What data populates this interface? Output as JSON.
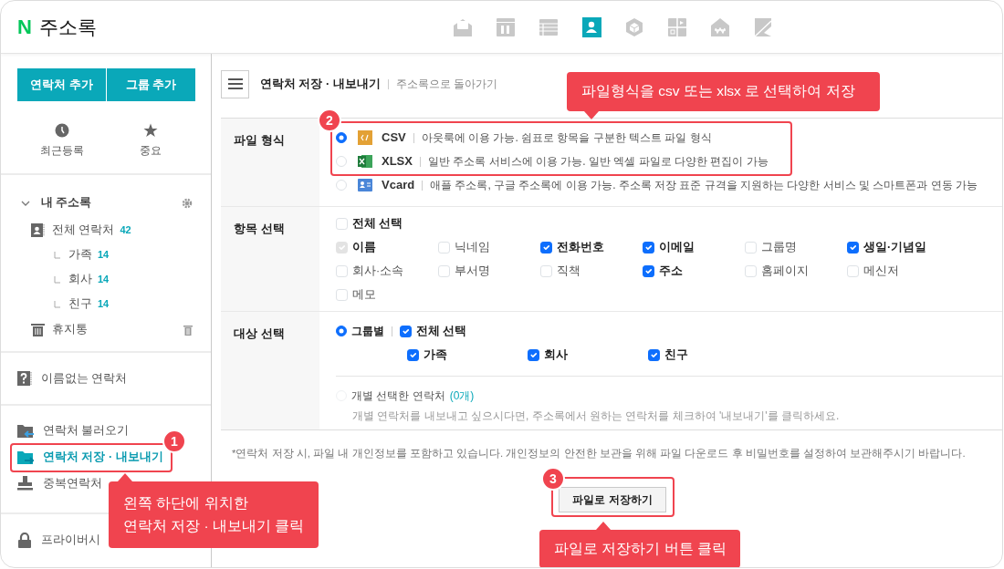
{
  "app": {
    "logo": "N",
    "title": "주소록"
  },
  "app_icons": [
    {
      "kind": "mail",
      "selected": false
    },
    {
      "kind": "calendar",
      "selected": false
    },
    {
      "kind": "table",
      "selected": false
    },
    {
      "kind": "contacts",
      "selected": true
    },
    {
      "kind": "cube",
      "selected": false
    },
    {
      "kind": "grid",
      "selected": false
    },
    {
      "kind": "house",
      "selected": false
    },
    {
      "kind": "flag",
      "selected": false
    }
  ],
  "sidebar": {
    "buttons": [
      "연락처 추가",
      "그룹 추가"
    ],
    "shortcuts": [
      {
        "kind": "clock",
        "label": "최근등록"
      },
      {
        "kind": "star",
        "label": "중요"
      }
    ],
    "my_addressbook": {
      "title": "내 주소록",
      "expanded": true,
      "items": [
        {
          "kind": "all",
          "label": "전체 연락처",
          "count": "42",
          "children": [
            {
              "label": "가족",
              "count": "14"
            },
            {
              "label": "회사",
              "count": "14"
            },
            {
              "label": "친구",
              "count": "14"
            }
          ]
        },
        {
          "kind": "trash",
          "label": "휴지통"
        }
      ]
    },
    "unnamed": "이름없는 연락처",
    "tools": [
      {
        "kind": "import",
        "label": "연락처 불러오기",
        "selected": false
      },
      {
        "kind": "export",
        "label": "연락처 저장 · 내보내기",
        "selected": true
      },
      {
        "kind": "dedupe",
        "label": "중복연락처",
        "selected": false
      }
    ],
    "privacy": "프라이버시"
  },
  "page": {
    "title": "연락처 저장 · 내보내기",
    "back_link": "주소록으로 돌아가기"
  },
  "form": {
    "file_format": {
      "label": "파일 형식",
      "options": [
        {
          "kind": "csv",
          "name": "CSV",
          "description": "아웃룩에 이용 가능. 쉼표로 항목을 구분한 텍스트 파일 형식",
          "selected": true
        },
        {
          "kind": "xlsx",
          "name": "XLSX",
          "description": "일반 주소록 서비스에 이용 가능. 일반 엑셀 파일로 다양한 편집이 가능",
          "selected": false
        },
        {
          "kind": "vcard",
          "name": "Vcard",
          "description": "애플 주소록, 구글 주소록에 이용 가능. 주소록 저장 표준 규격을 지원하는 다양한 서비스 및 스마트폰과 연동 가능",
          "selected": false
        }
      ]
    },
    "fields": {
      "label": "항목 선택",
      "select_all": {
        "label": "전체 선택",
        "checked": false
      },
      "items": [
        {
          "label": "이름",
          "checked": true,
          "disabled": true
        },
        {
          "label": "닉네임",
          "checked": false,
          "disabled": false
        },
        {
          "label": "전화번호",
          "checked": true,
          "disabled": false
        },
        {
          "label": "이메일",
          "checked": true,
          "disabled": false
        },
        {
          "label": "그룹명",
          "checked": false,
          "disabled": false
        },
        {
          "label": "생일·기념일",
          "checked": true,
          "disabled": false
        },
        {
          "label": "회사·소속",
          "checked": false,
          "disabled": false
        },
        {
          "label": "부서명",
          "checked": false,
          "disabled": false
        },
        {
          "label": "직책",
          "checked": false,
          "disabled": false
        },
        {
          "label": "주소",
          "checked": true,
          "disabled": false
        },
        {
          "label": "홈페이지",
          "checked": false,
          "disabled": false
        },
        {
          "label": "메신저",
          "checked": false,
          "disabled": false
        },
        {
          "label": "메모",
          "checked": false,
          "disabled": false
        }
      ]
    },
    "target": {
      "label": "대상 선택",
      "by_group": {
        "label": "그룹별",
        "selected": true
      },
      "select_all": {
        "label": "전체 선택",
        "checked": true
      },
      "groups": [
        {
          "label": "가족",
          "checked": true
        },
        {
          "label": "회사",
          "checked": true
        },
        {
          "label": "친구",
          "checked": true
        }
      ],
      "individual": {
        "label": "개별 선택한 연락처",
        "count": "(0개)",
        "selected": false,
        "disabled": true,
        "hint": "개별 연락처를 내보내고 싶으시다면, 주소록에서 원하는 연락처를 체크하여 '내보내기'를 클릭하세요."
      }
    }
  },
  "notice": "*연락처 저장 시, 파일 내 개인정보를 포함하고 있습니다. 개인정보의 안전한 보관을 위해 파일 다운로드 후 비밀번호를 설정하여 보관해주시기 바랍니다.",
  "save_button": "파일로 저장하기",
  "annotations": [
    {
      "number": "1",
      "lines": [
        "왼쪽 하단에 위치한",
        "연락처 저장 · 내보내기 클릭"
      ]
    },
    {
      "number": "2",
      "lines": [
        "파일형식을 csv 또는 xlsx 로 선택하여 저장"
      ]
    },
    {
      "number": "3",
      "lines": [
        "파일로 저장하기 버튼 클릭"
      ]
    }
  ]
}
